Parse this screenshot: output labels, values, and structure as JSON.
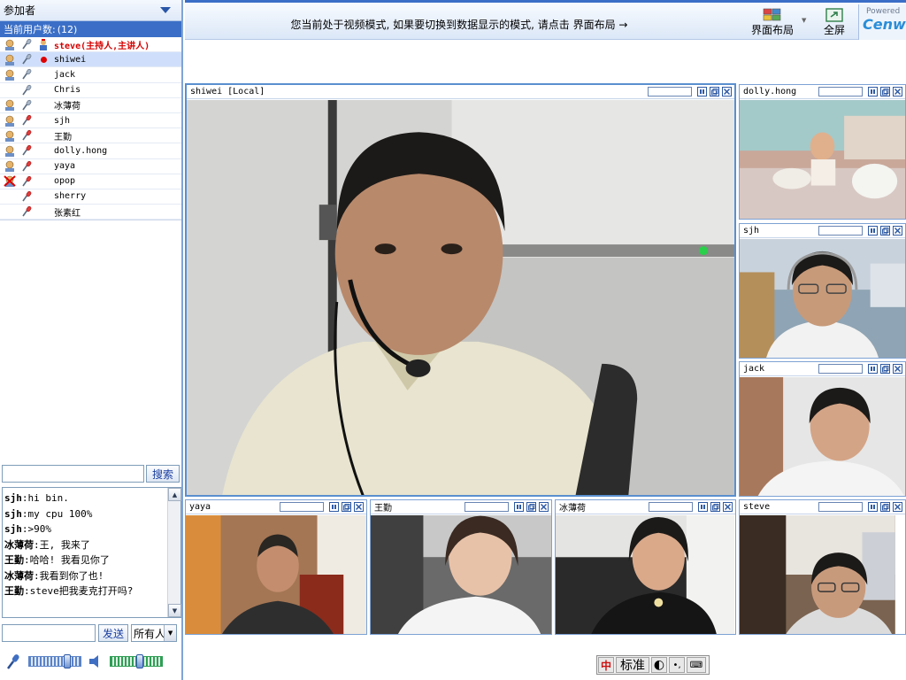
{
  "sidebar": {
    "header": "参加者",
    "count_label": "当前用户数:",
    "count_value": "(12)",
    "users": [
      {
        "name": "steve",
        "suffix": "(主持人,主讲人)",
        "host": true,
        "cam": "on",
        "mic": "on",
        "selected": false
      },
      {
        "name": "shiwei",
        "suffix": "",
        "host": false,
        "cam": "on",
        "mic": "on",
        "selected": true
      },
      {
        "name": "jack",
        "suffix": "",
        "host": false,
        "cam": "on",
        "mic": "on",
        "selected": false
      },
      {
        "name": "Chris",
        "suffix": "",
        "host": false,
        "cam": "none",
        "mic": "on",
        "selected": false
      },
      {
        "name": "冰薄荷",
        "suffix": "",
        "host": false,
        "cam": "on",
        "mic": "on",
        "selected": false
      },
      {
        "name": "sjh",
        "suffix": "",
        "host": false,
        "cam": "on",
        "mic": "red",
        "selected": false
      },
      {
        "name": "王勤",
        "suffix": "",
        "host": false,
        "cam": "on",
        "mic": "red",
        "selected": false
      },
      {
        "name": "dolly.hong",
        "suffix": "",
        "host": false,
        "cam": "on",
        "mic": "red",
        "selected": false
      },
      {
        "name": "yaya",
        "suffix": "",
        "host": false,
        "cam": "on",
        "mic": "red",
        "selected": false
      },
      {
        "name": "opop",
        "suffix": "",
        "host": false,
        "cam": "off",
        "mic": "red",
        "selected": false
      },
      {
        "name": "sherry",
        "suffix": "",
        "host": false,
        "cam": "none",
        "mic": "red",
        "selected": false
      },
      {
        "name": "张素红",
        "suffix": "",
        "host": false,
        "cam": "none",
        "mic": "red",
        "selected": false
      }
    ],
    "search_button": "搜索",
    "search_value": "",
    "chat": [
      {
        "who": "sjh",
        "msg": ":hi bin."
      },
      {
        "who": "sjh",
        "msg": ":my cpu 100%"
      },
      {
        "who": "sjh",
        "msg": ":>90%"
      },
      {
        "who": "冰薄荷",
        "msg": ":王, 我来了"
      },
      {
        "who": "王勤",
        "msg": ":哈哈! 我看见你了"
      },
      {
        "who": "冰薄荷",
        "msg": ":我看到你了也!"
      },
      {
        "who": "王勤",
        "msg": ":steve把我麦克打开吗?"
      }
    ],
    "send_button": "发送",
    "send_value": "",
    "recipient": "所有人",
    "mic_level": 0.75,
    "speaker_level": 0.55
  },
  "topbar": {
    "notice": "您当前处于视频模式, 如果要切换到数据显示的模式, 请点击 界面布局 →",
    "layout_button": "界面布局",
    "fullscreen_button": "全屏",
    "brand_powered": "Powered",
    "brand_name": "Cenwa"
  },
  "videos": [
    {
      "id": "main",
      "title": "shiwei [Local]"
    },
    {
      "id": "dolly",
      "title": "dolly.hong"
    },
    {
      "id": "sjh",
      "title": "sjh"
    },
    {
      "id": "jack",
      "title": "jack"
    },
    {
      "id": "yaya",
      "title": "yaya"
    },
    {
      "id": "wangqin",
      "title": "王勤"
    },
    {
      "id": "bingbohe",
      "title": "冰薄荷"
    },
    {
      "id": "steve",
      "title": "steve"
    }
  ],
  "ime": {
    "mode": "标准",
    "logo": "中"
  },
  "colors": {
    "accent": "#3b6fc7",
    "host": "#d40000",
    "border": "#7da2d4"
  }
}
